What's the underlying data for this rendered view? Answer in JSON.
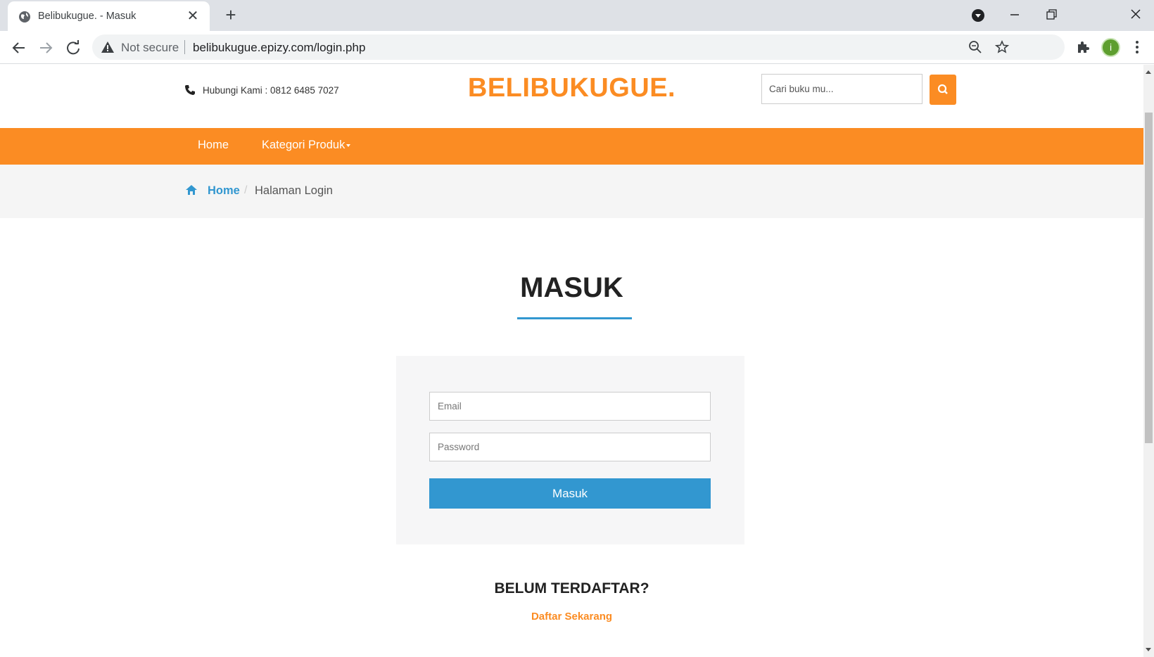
{
  "browser": {
    "tab_title": "Belibukugue. - Masuk",
    "new_tab_label": "+",
    "security_label": "Not secure",
    "url": "belibukugue.epizy.com/login.php",
    "profile_initial": "i"
  },
  "header": {
    "contact": "Hubungi Kami : 0812 6485 7027",
    "logo": "BELIBUKUGUE.",
    "search_placeholder": "Cari buku mu..."
  },
  "nav": {
    "items": [
      {
        "label": "Home"
      },
      {
        "label": "Kategori Produk"
      }
    ]
  },
  "breadcrumb": {
    "home": "Home",
    "separator": "/",
    "current": "Halaman Login"
  },
  "login": {
    "title": "MASUK",
    "email_placeholder": "Email",
    "password_placeholder": "Password",
    "submit_label": "Masuk"
  },
  "register": {
    "title": "BELUM TERDAFTAR?",
    "link_label": "Daftar Sekarang"
  },
  "colors": {
    "brand_orange": "#fb8c23",
    "accent_blue": "#3297d0"
  }
}
